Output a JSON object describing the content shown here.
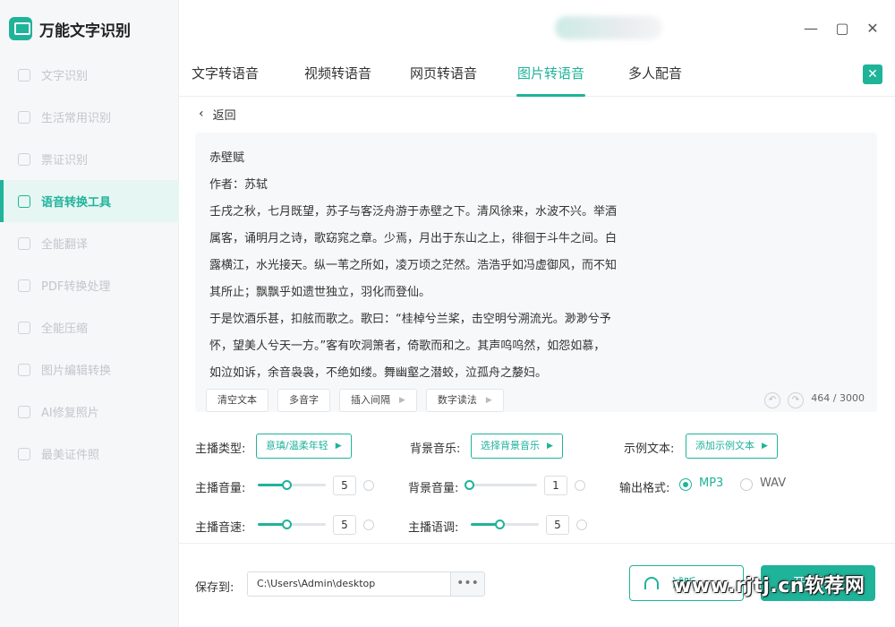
{
  "app": {
    "name": "万能文字识别"
  },
  "window": {
    "minimize": "—",
    "maximize": "▢",
    "close": "✕"
  },
  "sidebar": {
    "items": [
      {
        "label": "文字识别"
      },
      {
        "label": "生活常用识别"
      },
      {
        "label": "票证识别"
      },
      {
        "label": "语音转换工具",
        "active": true
      },
      {
        "label": "全能翻译"
      },
      {
        "label": "PDF转换处理"
      },
      {
        "label": "全能压缩"
      },
      {
        "label": "图片编辑转换"
      },
      {
        "label": "AI修复照片"
      },
      {
        "label": "最美证件照"
      }
    ]
  },
  "tabs": {
    "items": [
      {
        "label": "文字转语音"
      },
      {
        "label": "视频转语音"
      },
      {
        "label": "网页转语音"
      },
      {
        "label": "图片转语音",
        "active": true
      },
      {
        "label": "多人配音"
      }
    ],
    "close": "✕"
  },
  "back": {
    "label": "返回",
    "icon": "‹"
  },
  "editor": {
    "lines": [
      "赤壁赋",
      "作者：苏轼",
      "壬戌之秋，七月既望，苏子与客泛舟游于赤壁之下。清风徐来，水波不兴。举酒",
      "属客，诵明月之诗，歌窈窕之章。少焉，月出于东山之上，徘徊于斗牛之间。白",
      "露横江，水光接天。纵一苇之所如，凌万顷之茫然。浩浩乎如冯虚御风，而不知",
      "其所止；飘飘乎如遗世独立，羽化而登仙。",
      "于是饮酒乐甚，扣舷而歌之。歌曰：“桂棹兮兰桨，击空明兮溯流光。渺渺兮予",
      "怀，望美人兮天一方。”客有吹洞箫者，倚歌而和之。其声呜呜然，如怨如慕，",
      "如泣如诉，余音袅袅，不绝如缕。舞幽壑之潜蛟，泣孤舟之嫠妇。"
    ],
    "buttons": {
      "clear": "清空文本",
      "polyphone": "多音字",
      "insert_pause": "插入间隔",
      "number_reading": "数字读法"
    },
    "counter": "464 / 3000"
  },
  "options": {
    "anchor_type": {
      "label": "主播类型:",
      "value": "意瑱/温柔年轻"
    },
    "bg_music": {
      "label": "背景音乐:",
      "value": "选择背景音乐"
    },
    "sample_text": {
      "label": "示例文本:",
      "value": "添加示例文本"
    },
    "anchor_volume": {
      "label": "主播音量:",
      "value": "5",
      "level": 0.42
    },
    "bg_volume": {
      "label": "背景音量:",
      "value": "1",
      "level": 0.0
    },
    "output_format": {
      "label": "输出格式:",
      "options": [
        "MP3",
        "WAV"
      ],
      "selected": "MP3"
    },
    "anchor_speed": {
      "label": "主播音速:",
      "value": "5",
      "level": 0.42
    },
    "anchor_pitch": {
      "label": "主播语调:",
      "value": "5",
      "level": 0.42
    }
  },
  "bottom": {
    "save_label": "保存到:",
    "path": "C:\\Users\\Admin\\desktop",
    "more": "•••",
    "listen": "试听",
    "start": "开始转换"
  },
  "watermark": "www.rjtj.cn软荐网",
  "colors": {
    "accent": "#1fb39a"
  }
}
